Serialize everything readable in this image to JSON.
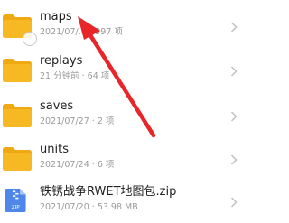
{
  "files": [
    {
      "name": "maps",
      "meta": "2021/07/… · 397 项",
      "icon": "folder-icon"
    },
    {
      "name": "replays",
      "meta": "21 分钟前 · 64 项",
      "icon": "folder-icon"
    },
    {
      "name": "saves",
      "meta": "2021/07/27 · 2 项",
      "icon": "folder-icon"
    },
    {
      "name": "units",
      "meta": "2021/07/24 · 6 项",
      "icon": "folder-icon"
    },
    {
      "name": "铁锈战争RWET地图包.zip",
      "meta": "2021/07/20 · 53.98 MB",
      "icon": "zip-file-icon",
      "badge": "ZIP"
    }
  ],
  "colors": {
    "folder": "#f6b923",
    "folder_tab": "#f1a913",
    "zip": "#4f86ea",
    "arrow": "#e8262a"
  }
}
